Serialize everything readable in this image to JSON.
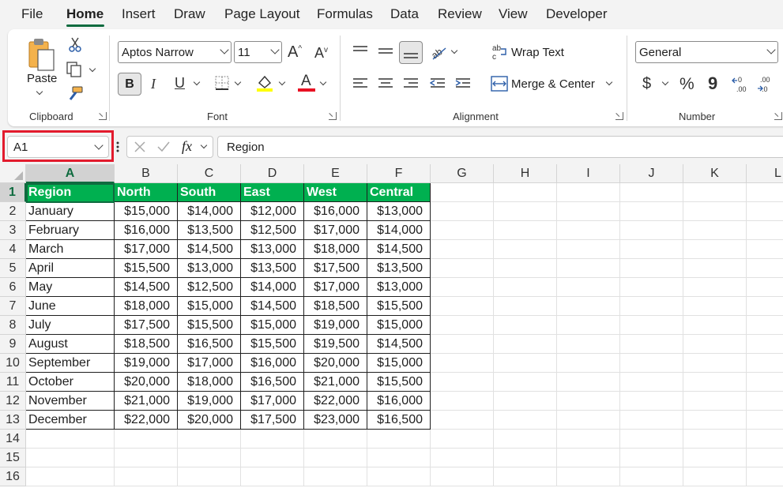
{
  "menu": [
    "File",
    "Home",
    "Insert",
    "Draw",
    "Page Layout",
    "Formulas",
    "Data",
    "Review",
    "View",
    "Developer"
  ],
  "ribbon": {
    "clipboard": {
      "paste": "Paste",
      "label": "Clipboard"
    },
    "font": {
      "name": "Aptos Narrow",
      "size": "11",
      "bold": "B",
      "italic": "I",
      "underline": "U",
      "label": "Font",
      "underline_color": "#e81123",
      "highlight_color": "#ffff00"
    },
    "alignment": {
      "wrap": "Wrap Text",
      "merge": "Merge & Center",
      "label": "Alignment"
    },
    "number": {
      "format": "General",
      "currency": "$",
      "percent": "%",
      "comma": "9",
      "label": "Number"
    }
  },
  "formula_bar": {
    "name_box": "A1",
    "fx": "fx",
    "value": "Region"
  },
  "columns": [
    "A",
    "B",
    "C",
    "D",
    "E",
    "F",
    "G",
    "H",
    "I",
    "J",
    "K",
    "L"
  ],
  "rows": [
    "1",
    "2",
    "3",
    "4",
    "5",
    "6",
    "7",
    "8",
    "9",
    "10",
    "11",
    "12",
    "13",
    "14",
    "15",
    "16"
  ],
  "table": {
    "header_color": "#00b050",
    "headers": [
      "Region",
      "North",
      "South",
      "East",
      "West",
      "Central"
    ],
    "rows": [
      [
        "January",
        "$15,000",
        "$14,000",
        "$12,000",
        "$16,000",
        "$13,000"
      ],
      [
        "February",
        "$16,000",
        "$13,500",
        "$12,500",
        "$17,000",
        "$14,000"
      ],
      [
        "March",
        "$17,000",
        "$14,500",
        "$13,000",
        "$18,000",
        "$14,500"
      ],
      [
        "April",
        "$15,500",
        "$13,000",
        "$13,500",
        "$17,500",
        "$13,500"
      ],
      [
        "May",
        "$14,500",
        "$12,500",
        "$14,000",
        "$17,000",
        "$13,000"
      ],
      [
        "June",
        "$18,000",
        "$15,000",
        "$14,500",
        "$18,500",
        "$15,500"
      ],
      [
        "July",
        "$17,500",
        "$15,500",
        "$15,000",
        "$19,000",
        "$15,000"
      ],
      [
        "August",
        "$18,500",
        "$16,500",
        "$15,500",
        "$19,500",
        "$14,500"
      ],
      [
        "September",
        "$19,000",
        "$17,000",
        "$16,000",
        "$20,000",
        "$15,000"
      ],
      [
        "October",
        "$20,000",
        "$18,000",
        "$16,500",
        "$21,000",
        "$15,500"
      ],
      [
        "November",
        "$21,000",
        "$19,000",
        "$17,000",
        "$22,000",
        "$16,000"
      ],
      [
        "December",
        "$22,000",
        "$20,000",
        "$17,500",
        "$23,000",
        "$16,500"
      ]
    ]
  }
}
